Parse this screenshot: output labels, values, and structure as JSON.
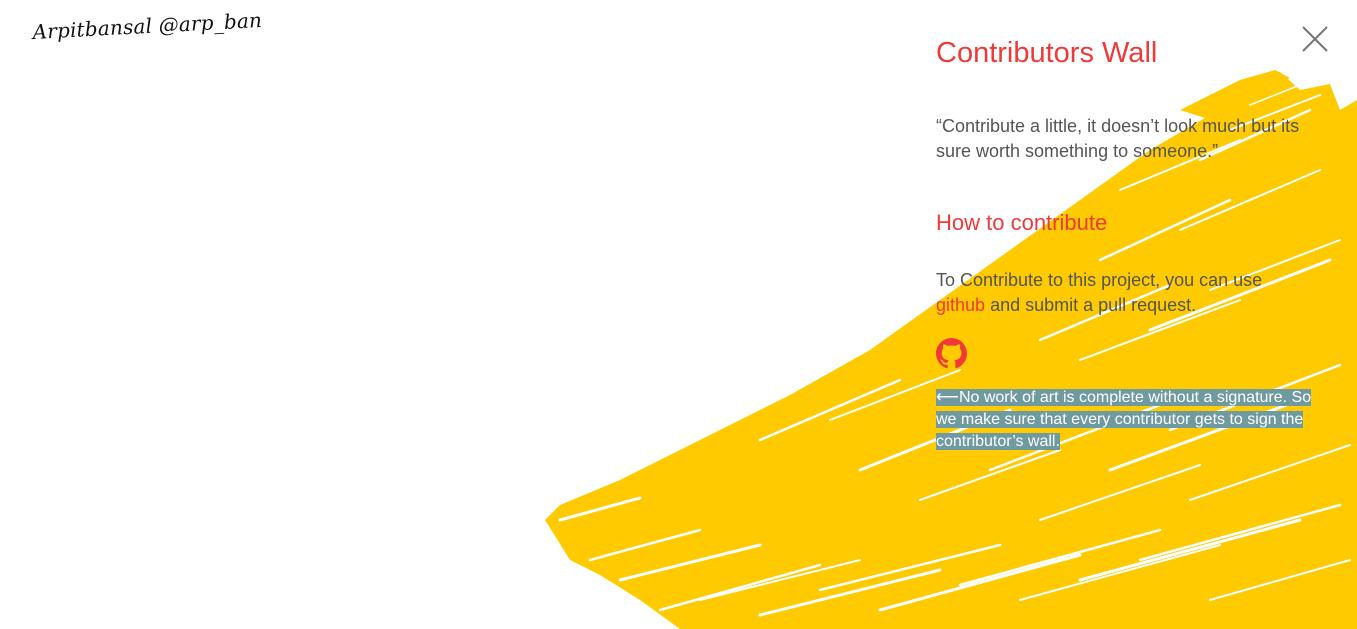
{
  "signature": "Arpitbansal @arp_ban",
  "panel": {
    "title": "Contributors Wall",
    "quote": "“Contribute a little, it doesn’t look much but its sure worth something to someone.”",
    "how_to_heading": "How to contribute",
    "instructions_before": "To Contribute to this project, you can use",
    "github_link_label": "github",
    "instructions_after": "and submit a pull request.",
    "note_arrow": "⟵",
    "note": "No work of art is complete without a signature. So we make sure that every contributor gets to sign the contributor’s wall."
  },
  "icons": {
    "close": "close-icon",
    "github": "github-icon"
  },
  "colors": {
    "accent": "#f03a3a",
    "stroke": "#ffcb00",
    "text": "#555555",
    "highlight": "#6f9aa0"
  }
}
